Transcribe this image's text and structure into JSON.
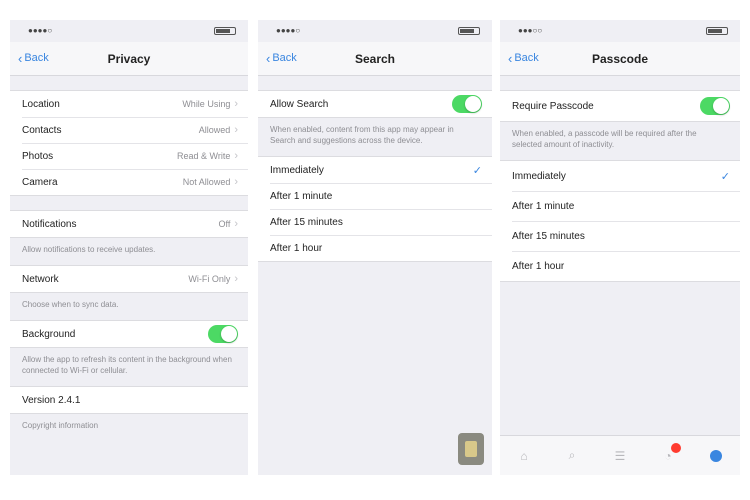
{
  "panel1": {
    "status": {
      "carrier": "●●●●○",
      "time": "",
      "battery": ""
    },
    "nav": {
      "back": "Back",
      "title": "Privacy"
    },
    "rows_group1": [
      {
        "label": "Location",
        "value": "While Using"
      },
      {
        "label": "Contacts",
        "value": "Allowed"
      },
      {
        "label": "Photos",
        "value": "Read & Write"
      },
      {
        "label": "Camera",
        "value": "Not Allowed"
      }
    ],
    "row_notifications": {
      "label": "Notifications",
      "value": "Off"
    },
    "footer_notifications": "Allow notifications to receive updates.",
    "row_network": {
      "label": "Network",
      "value": "Wi-Fi Only"
    },
    "footer_network": "Choose when to sync data.",
    "row_background": {
      "label": "Background"
    },
    "footer_background": "Allow the app to refresh its content in the background when connected to Wi-Fi or cellular.",
    "row_version": {
      "label": "Version 2.4.1"
    },
    "footer_version": "Copyright information"
  },
  "panel2": {
    "status": {
      "carrier": "●●●●○",
      "time": ""
    },
    "nav": {
      "back": "Back",
      "title": "Search"
    },
    "toggle": {
      "label": "Allow Search"
    },
    "footer": "When enabled, content from this app may appear in Search and suggestions across the device.",
    "options": [
      {
        "label": "Immediately",
        "checked": true
      },
      {
        "label": "After 1 minute",
        "checked": false
      },
      {
        "label": "After 15 minutes",
        "checked": false
      },
      {
        "label": "After 1 hour",
        "checked": false
      }
    ]
  },
  "panel3": {
    "status": {
      "carrier": "●●●○○",
      "time": "",
      "battery": ""
    },
    "nav": {
      "back": "Back",
      "title": "Passcode"
    },
    "toggle": {
      "label": "Require Passcode"
    },
    "footer": "When enabled, a passcode will be required after the selected amount of inactivity.",
    "options": [
      {
        "label": "Immediately",
        "checked": true
      },
      {
        "label": "After 1 minute",
        "checked": false
      },
      {
        "label": "After 15 minutes",
        "checked": false
      },
      {
        "label": "After 1 hour",
        "checked": false
      }
    ],
    "tabs": [
      {
        "icon": "home-icon"
      },
      {
        "icon": "search-icon"
      },
      {
        "icon": "list-icon"
      },
      {
        "icon": "bell-icon",
        "badge": true
      },
      {
        "icon": "profile-icon",
        "active": true
      }
    ]
  },
  "colors": {
    "accent": "#3a86e0",
    "toggle_on": "#4cd964",
    "badge": "#ff3b30",
    "background": "#efeff4"
  }
}
